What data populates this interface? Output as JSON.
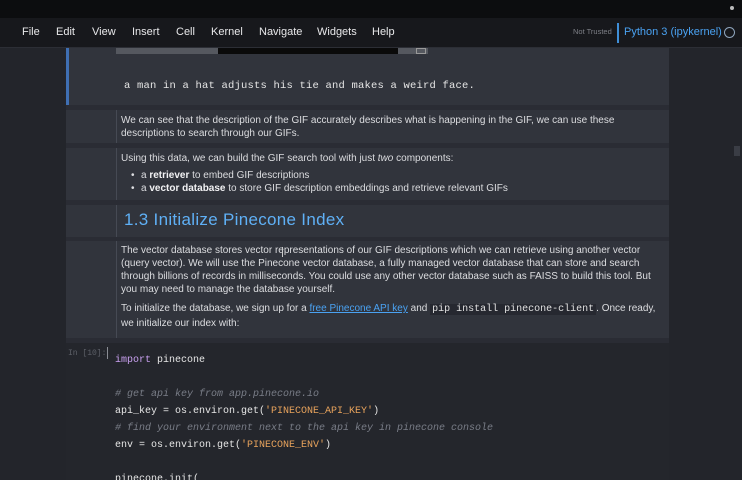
{
  "menubar": {
    "items": [
      "File",
      "Edit",
      "View",
      "Insert",
      "Cell",
      "Kernel",
      "Navigate",
      "Widgets",
      "Help"
    ],
    "not_trusted": "Not Trusted",
    "kernel": "Python 3 (ipykernel)"
  },
  "cells": {
    "output_text": "a man in a hat adjusts his tie and makes a weird face.",
    "md1": "We can see that the description of the GIF accurately describes what is happening in the GIF, we can use these descriptions to search through our GIFs.",
    "md2_intro_a": "Using this data, we can build the GIF search tool with just ",
    "md2_intro_em": "two",
    "md2_intro_b": " components:",
    "md2_items": [
      {
        "bold": "retriever",
        "rest": " to embed GIF descriptions",
        "pre": "a "
      },
      {
        "bold": "vector database",
        "rest": " to store GIF description embeddings and retrieve relevant GIFs",
        "pre": "a "
      }
    ],
    "heading": "1.3  Initialize Pinecone Index",
    "md3_p1": "The vector database stores vector representations of our GIF descriptions which we can retrieve using another vector (query vector). We will use the Pinecone vector database, a fully managed vector database that can store and search through billions of records in milliseconds. You could use any other vector database such as FAISS to build this tool. But you may need to manage the database yourself.",
    "md3_p2_a": "To initialize the database, we sign up for a ",
    "md3_p2_link": "free Pinecone API key",
    "md3_p2_b": " and ",
    "md3_p2_code": "pip install pinecone-client",
    "md3_p2_c": ". Once ready, we initialize our index with:",
    "in_prompt": "In [10]:",
    "code": {
      "l1_kw": "import",
      "l1_rest": " pinecone",
      "l2_comment": "# get api key from app.pinecone.io",
      "l3_a": "api_key = os.environ.get(",
      "l3_str": "'PINECONE_API_KEY'",
      "l3_b": ")",
      "l4_comment": "# find your environment next to the api key in pinecone console",
      "l5_a": "env = os.environ.get(",
      "l5_str": "'PINECONE_ENV'",
      "l5_b": ")",
      "l6": "pinecone.init("
    }
  }
}
